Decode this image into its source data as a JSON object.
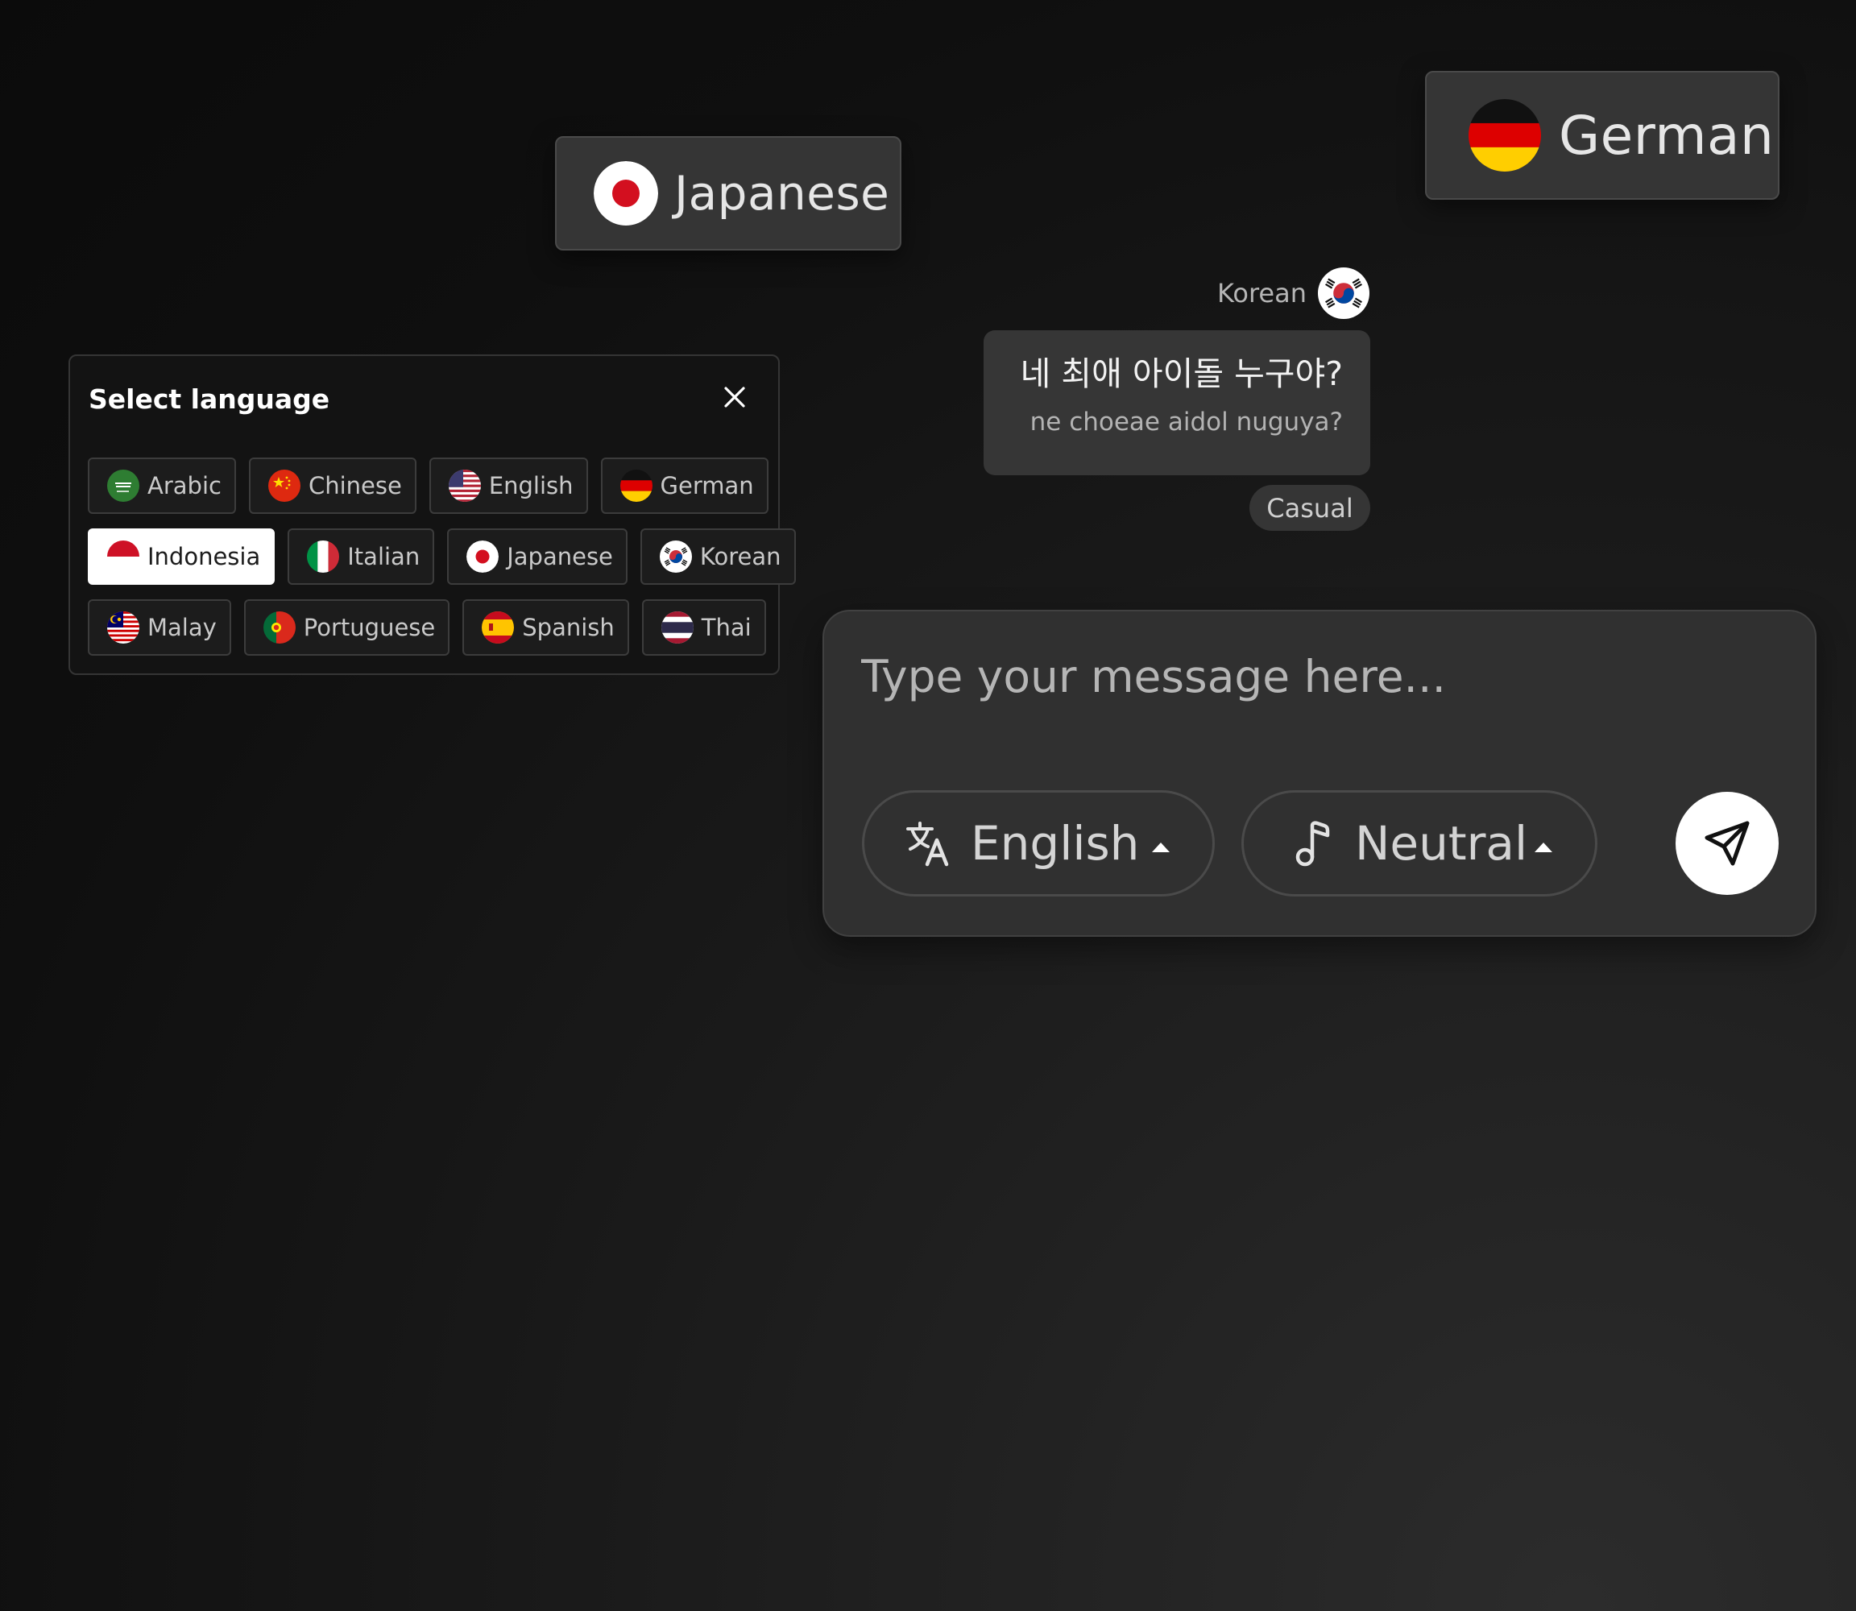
{
  "floating_chips": {
    "japanese": {
      "label": "Japanese",
      "flag_icon": "japan-flag-icon"
    },
    "german": {
      "label": "German",
      "flag_icon": "germany-flag-icon"
    }
  },
  "language_panel": {
    "title": "Select language",
    "close_icon": "close-icon",
    "selected": "Indonesia",
    "languages": [
      {
        "label": "Arabic",
        "flag_icon": "saudi-arabia-flag-icon"
      },
      {
        "label": "Chinese",
        "flag_icon": "china-flag-icon"
      },
      {
        "label": "English",
        "flag_icon": "usa-flag-icon"
      },
      {
        "label": "German",
        "flag_icon": "germany-flag-icon"
      },
      {
        "label": "Indonesia",
        "flag_icon": "indonesia-flag-icon"
      },
      {
        "label": "Italian",
        "flag_icon": "italy-flag-icon"
      },
      {
        "label": "Japanese",
        "flag_icon": "japan-flag-icon"
      },
      {
        "label": "Korean",
        "flag_icon": "south-korea-flag-icon"
      },
      {
        "label": "Malay",
        "flag_icon": "malaysia-flag-icon"
      },
      {
        "label": "Portuguese",
        "flag_icon": "portugal-flag-icon"
      },
      {
        "label": "Spanish",
        "flag_icon": "spain-flag-icon"
      },
      {
        "label": "Thai",
        "flag_icon": "thailand-flag-icon"
      }
    ]
  },
  "message": {
    "language_label": "Korean",
    "flag_icon": "south-korea-flag-icon",
    "text": "네 최애 아이돌 누구야?",
    "romanized": "ne choeae aidol nuguya?",
    "tone": "Casual"
  },
  "composer": {
    "placeholder": "Type your message here...",
    "language_button": {
      "label": "English",
      "icon": "translate-icon"
    },
    "tone_button": {
      "label": "Neutral",
      "icon": "music-note-icon"
    },
    "send_icon": "send-icon"
  },
  "colors": {
    "background": "#0f0f0f",
    "panel_bg": "#131313",
    "chip_bg": "#353535",
    "composer_bg": "#303030",
    "selected_chip_bg": "#ffffff"
  }
}
